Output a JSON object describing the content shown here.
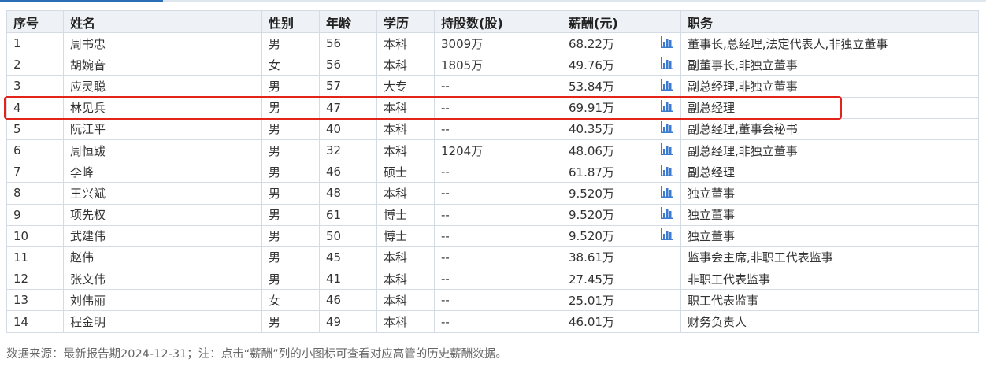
{
  "headers": {
    "seq": "序号",
    "name": "姓名",
    "gender": "性别",
    "age": "年龄",
    "education": "学历",
    "shares": "持股数(股)",
    "salary": "薪酬(元)",
    "position": "职务"
  },
  "rows": [
    {
      "seq": "1",
      "name": "周书忠",
      "gender": "男",
      "age": "56",
      "education": "本科",
      "shares": "3009万",
      "salary": "68.22万",
      "salary_icon": "bar-chart-icon",
      "position": "董事长,总经理,法定代表人,非独立董事"
    },
    {
      "seq": "2",
      "name": "胡婉音",
      "gender": "女",
      "age": "56",
      "education": "本科",
      "shares": "1805万",
      "salary": "49.76万",
      "salary_icon": "bar-chart-icon",
      "position": "副董事长,非独立董事"
    },
    {
      "seq": "3",
      "name": "应灵聪",
      "gender": "男",
      "age": "57",
      "education": "大专",
      "shares": "--",
      "salary": "53.84万",
      "salary_icon": "bar-chart-icon",
      "position": "副总经理,非独立董事"
    },
    {
      "seq": "4",
      "name": "林见兵",
      "gender": "男",
      "age": "47",
      "education": "本科",
      "shares": "--",
      "salary": "69.91万",
      "salary_icon": "bar-chart-icon",
      "position": "副总经理"
    },
    {
      "seq": "5",
      "name": "阮江平",
      "gender": "男",
      "age": "40",
      "education": "本科",
      "shares": "--",
      "salary": "40.35万",
      "salary_icon": "bar-chart-icon",
      "position": "副总经理,董事会秘书"
    },
    {
      "seq": "6",
      "name": "周恒跋",
      "gender": "男",
      "age": "32",
      "education": "本科",
      "shares": "1204万",
      "salary": "48.06万",
      "salary_icon": "bar-chart-icon",
      "position": "副总经理,非独立董事"
    },
    {
      "seq": "7",
      "name": "李峰",
      "gender": "男",
      "age": "46",
      "education": "硕士",
      "shares": "--",
      "salary": "61.87万",
      "salary_icon": "bar-chart-icon",
      "position": "副总经理"
    },
    {
      "seq": "8",
      "name": "王兴斌",
      "gender": "男",
      "age": "48",
      "education": "本科",
      "shares": "--",
      "salary": "9.520万",
      "salary_icon": "bar-chart-icon",
      "position": "独立董事"
    },
    {
      "seq": "9",
      "name": "项先权",
      "gender": "男",
      "age": "61",
      "education": "博士",
      "shares": "--",
      "salary": "9.520万",
      "salary_icon": "bar-chart-icon",
      "position": "独立董事"
    },
    {
      "seq": "10",
      "name": "武建伟",
      "gender": "男",
      "age": "50",
      "education": "博士",
      "shares": "--",
      "salary": "9.520万",
      "salary_icon": "bar-chart-icon",
      "position": "独立董事"
    },
    {
      "seq": "11",
      "name": "赵伟",
      "gender": "男",
      "age": "45",
      "education": "本科",
      "shares": "--",
      "salary": "38.61万",
      "salary_icon": "",
      "position": "监事会主席,非职工代表监事"
    },
    {
      "seq": "12",
      "name": "张文伟",
      "gender": "男",
      "age": "41",
      "education": "本科",
      "shares": "--",
      "salary": "27.45万",
      "salary_icon": "",
      "position": "非职工代表监事"
    },
    {
      "seq": "13",
      "name": "刘伟丽",
      "gender": "女",
      "age": "46",
      "education": "本科",
      "shares": "--",
      "salary": "25.01万",
      "salary_icon": "",
      "position": "职工代表监事"
    },
    {
      "seq": "14",
      "name": "程金明",
      "gender": "男",
      "age": "49",
      "education": "本科",
      "shares": "--",
      "salary": "46.01万",
      "salary_icon": "",
      "position": "财务负责人"
    }
  ],
  "highlighted_row": "4",
  "footnote": "数据来源：最新报告期2024-12-31；注：点击“薪酬”列的小图标可查看对应高管的历史薪酬数据。",
  "colors": {
    "accent": "#2a6fb6",
    "highlight": "#e2241a",
    "icon": "#3b7bd0"
  }
}
